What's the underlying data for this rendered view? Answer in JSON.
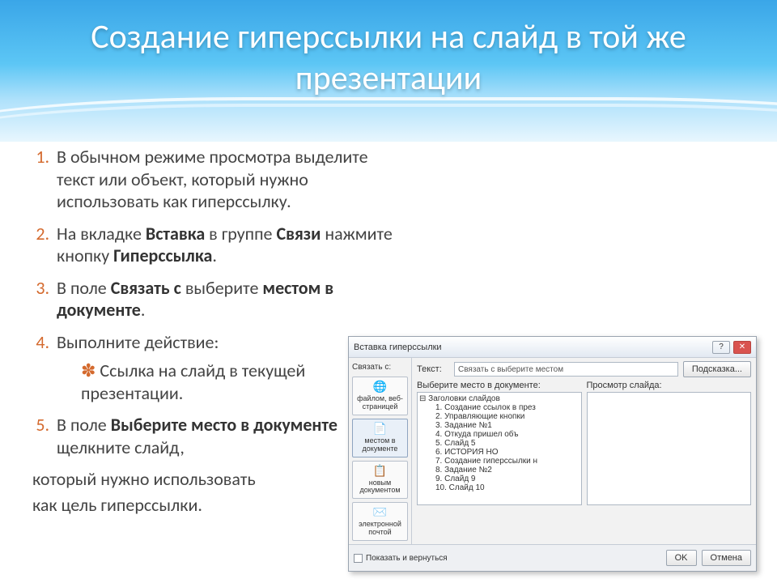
{
  "title": "Создание гиперссылки на слайд в той же презентации",
  "steps": {
    "s1": "В обычном режиме просмотра выделите текст или объект, который нужно использовать как гиперссылку.",
    "s2a": "На вкладке ",
    "s2b": "Вставка",
    "s2c": " в группе ",
    "s2d": "Связи",
    "s2e": " нажмите кнопку ",
    "s2f": "Гиперссылка",
    "s2g": ".",
    "s3a": "В поле ",
    "s3b": "Связать с",
    "s3c": " выберите ",
    "s3d": "местом в документе",
    "s3e": ".",
    "s4": "Выполните действие:",
    "s4_sub": "Ссылка на слайд в текущей презентации.",
    "s5a": "В поле ",
    "s5b": "Выберите место в документе",
    "s5c": " щелкните слайд,"
  },
  "tail1": "который нужно использовать",
  "tail2": "как цель гиперссылки.",
  "dialog": {
    "title": "Вставка гиперссылки",
    "help": "?",
    "close": "✕",
    "link_to": "Связать с:",
    "text_lbl": "Текст:",
    "text_val": "Связать с выберите местом",
    "hint_btn": "Подсказка...",
    "side": {
      "b1": "файлом, веб-страницей",
      "b2": "местом в документе",
      "b3": "новым документом",
      "b4": "электронной почтой"
    },
    "choose_lbl": "Выберите место в документе:",
    "preview_lbl": "Просмотр слайда:",
    "tree_root": "⊟ Заголовки слайдов",
    "tree_items": [
      "1. Создание ссылок в през",
      "2. Управляющие кнопки",
      "3. Задание №1",
      "4. Откуда пришел        объ",
      "5. Слайд 5",
      "6.         ИСТОРИЯ      НО",
      "7. Создание гиперссылки н",
      "8. Задание №2",
      "9. Слайд 9",
      "10. Слайд 10"
    ],
    "show_return": "Показать и вернуться",
    "ok": "OK",
    "cancel": "Отмена"
  }
}
